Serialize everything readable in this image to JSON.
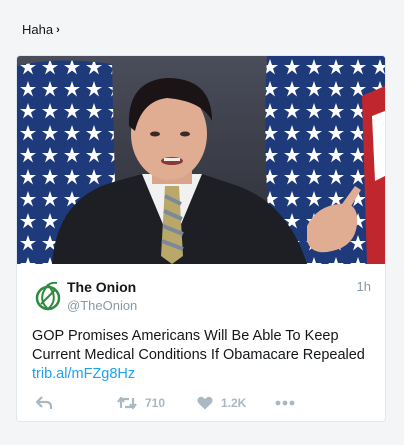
{
  "header": {
    "label": "Haha",
    "chevron": "chevron-right-icon"
  },
  "tweet": {
    "name": "The Onion",
    "handle": "@TheOnion",
    "time": "1h",
    "text": "GOP Promises Americans Will Be Able To Keep Current Medical Conditions If Obamacare Repealed",
    "link": "trib.al/mFZg8Hz",
    "avatar_icon": "onion-logo-icon",
    "brand_color": "#2d8a3e",
    "link_color": "#1da1f2"
  },
  "actions": {
    "reply_icon": "reply-icon",
    "retweet_icon": "retweet-icon",
    "retweets": "710",
    "like_icon": "heart-icon",
    "likes": "1.2K",
    "more_icon": "more-dots-icon"
  }
}
